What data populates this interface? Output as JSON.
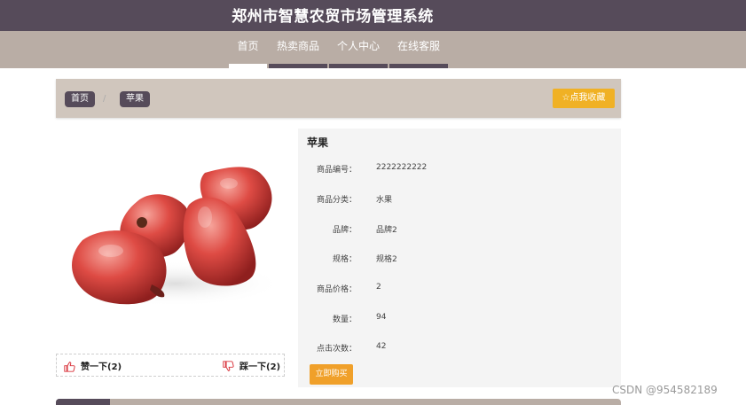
{
  "header": {
    "title": "郑州市智慧农贸市场管理系统"
  },
  "nav": {
    "items": [
      "首页",
      "热卖商品",
      "个人中心",
      "在线客服"
    ]
  },
  "breadcrumb": {
    "home": "首页",
    "current": "苹果"
  },
  "favorite_button": "☆点我收藏",
  "product": {
    "name": "苹果",
    "fields": [
      {
        "label": "商品编号：",
        "value": "2222222222"
      },
      {
        "label": "商品分类：",
        "value": "水果"
      },
      {
        "label": "品牌：",
        "value": "品牌2"
      },
      {
        "label": "规格：",
        "value": "规格2"
      },
      {
        "label": "商品价格：",
        "value": "2"
      },
      {
        "label": "数量：",
        "value": "94"
      },
      {
        "label": "点击次数：",
        "value": "42"
      }
    ],
    "buy_button": "立即购买"
  },
  "likes": {
    "like_label": "赞一下(2)",
    "dislike_label": "踩一下(2)"
  },
  "icons": {
    "like": "thumbs-up-icon",
    "dislike": "thumbs-down-icon",
    "favorite": "star-icon"
  },
  "colors": {
    "header": "#564b5a",
    "nav": "#b9ada5",
    "accent": "#f0b125",
    "icon_red": "#d9363e"
  },
  "watermark": "CSDN @954582189"
}
